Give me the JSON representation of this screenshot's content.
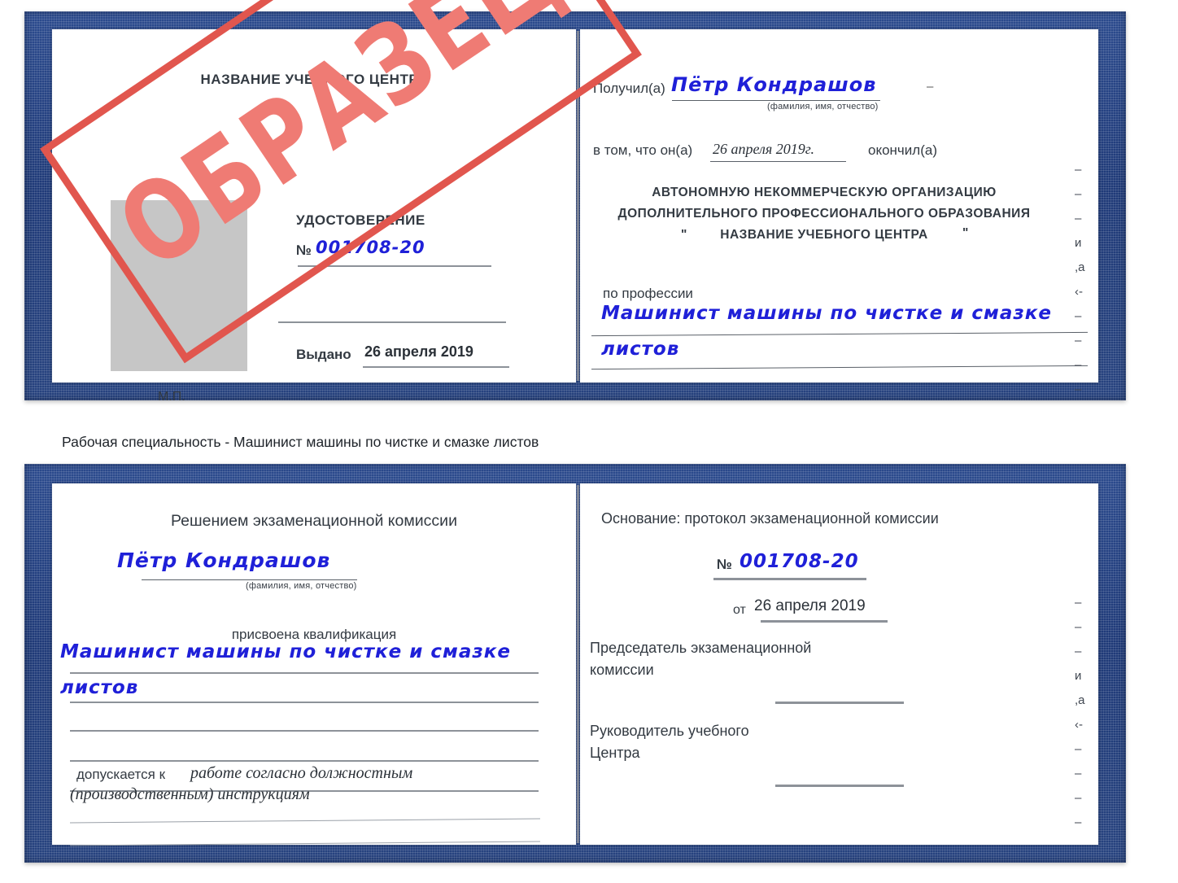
{
  "caption": "Рабочая специальность - Машинист машины по чистке и смазке листов",
  "stamp": {
    "text": "ОБРАЗЕЦ",
    "border_color": "#e1564e",
    "text_color": "#ef7b74"
  },
  "colors": {
    "cover_blue": "#1f3a78",
    "handwriting_blue": "#1f20d8",
    "paper_white": "#ffffff",
    "photo_placeholder_grey": "#c6c6c6",
    "rule_grey": "#8d9299"
  },
  "certificate_top": {
    "left_page": {
      "heading": "НАЗВАНИЕ УЧЕБНОГО ЦЕНТРА",
      "doc_type": "УДОСТОВЕРЕНИЕ",
      "number_label": "№",
      "number_value": "001708-20",
      "issued_label": "Выдано",
      "issued_value": "26 апреля 2019",
      "seal_label": "М.П."
    },
    "right_page": {
      "received_label": "Получил(а)",
      "received_value": "Пётр Кондрашов",
      "name_hint": "(фамилия, имя, отчество)",
      "that_he_label": "в том, что он(а)",
      "that_he_value": "26 апреля 2019г.",
      "graduated_label": "окончил(а)",
      "org_line1": "АВТОНОМНУЮ НЕКОММЕРЧЕСКУЮ ОРГАНИЗАЦИЮ",
      "org_line2": "ДОПОЛНИТЕЛЬНОГО ПРОФЕССИОНАЛЬНОГО ОБРАЗОВАНИЯ",
      "org_quote_open": "\"",
      "org_line3": "НАЗВАНИЕ УЧЕБНОГО ЦЕНТРА",
      "org_quote_close": "\"",
      "profession_label": "по профессии",
      "profession_value_line1": "Машинист машины по чистке и смазке",
      "profession_value_line2": "листов",
      "clipped_edge": "–\n–\n–\nи\n,а\n‹-\n–\n–\n–\n–"
    }
  },
  "certificate_bottom": {
    "left_page": {
      "heading": "Решением экзаменационной комиссии",
      "name_value": "Пётр Кондрашов",
      "name_hint": "(фамилия, имя, отчество)",
      "qualification_label": "присвоена квалификация",
      "qualification_value_line1": "Машинист машины по чистке и смазке",
      "qualification_value_line2": "листов",
      "admitted_label": "допускается к",
      "admitted_value_line1": "работе согласно должностным",
      "admitted_value_line2": "(производственным) инструкциям"
    },
    "right_page": {
      "basis_label": "Основание: протокол экзаменационной комиссии",
      "number_label": "№",
      "number_value": "001708-20",
      "date_label": "от",
      "date_value": "26 апреля 2019",
      "chairman_line1": "Председатель экзаменационной",
      "chairman_line2": "комиссии",
      "head_line1": "Руководитель учебного",
      "head_line2": "Центра",
      "clipped_edge": "–\n–\n–\nи\n,а\n‹-\n–\n–\n–\n–"
    }
  }
}
